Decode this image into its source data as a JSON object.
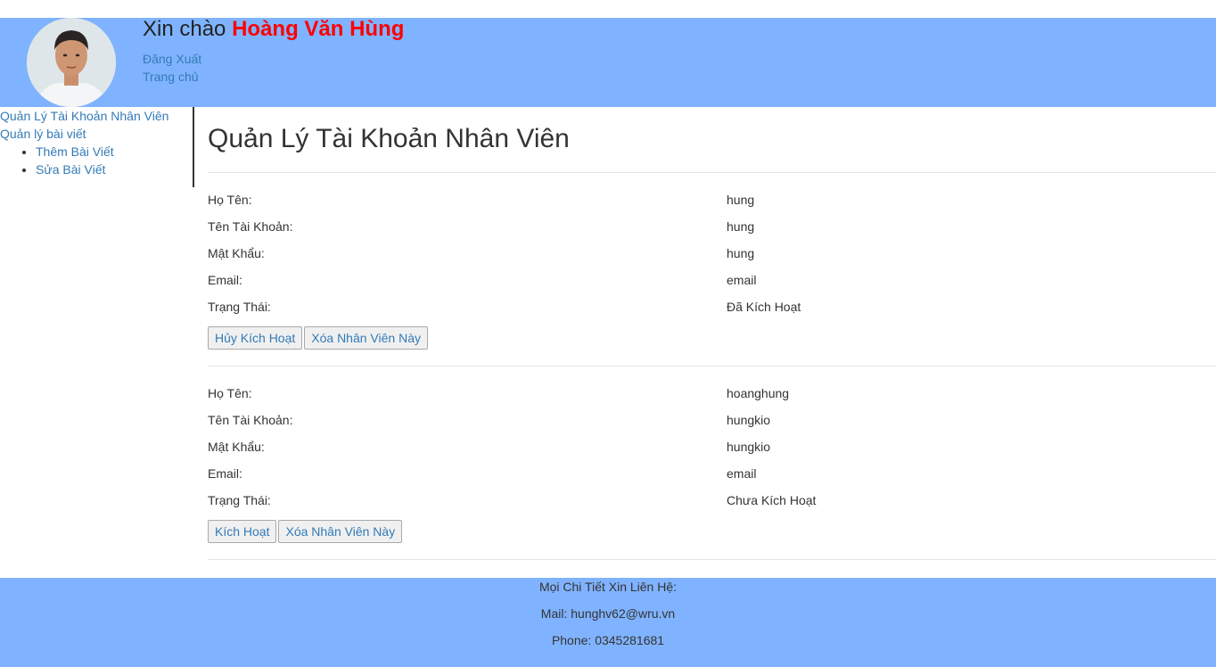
{
  "header": {
    "greeting_prefix": "Xin chào",
    "user_name": "Hoàng Văn Hùng",
    "logout_label": "Đăng Xuất",
    "home_label": "Trang chủ"
  },
  "sidebar": {
    "accounts_label": "Quản Lý Tài Khoản Nhân Viên",
    "posts_label": "Quản lý bài viết",
    "sub_items": [
      {
        "label": "Thêm Bài Viết"
      },
      {
        "label": "Sửa Bài Viết"
      }
    ]
  },
  "main": {
    "title": "Quản Lý Tài Khoản Nhân Viên",
    "field_labels": {
      "name": "Họ Tên:",
      "username": "Tên Tài Khoản:",
      "password": "Mật Khẩu:",
      "email": "Email:",
      "status": "Trạng Thái:"
    },
    "employees": [
      {
        "name": "hung",
        "username": "hung",
        "password": "hung",
        "email": "email",
        "status": "Đã Kích Hoạt",
        "toggle_label": "Hủy Kích Hoạt",
        "delete_label": "Xóa Nhân Viên Này"
      },
      {
        "name": "hoanghung",
        "username": "hungkio",
        "password": "hungkio",
        "email": "email",
        "status": "Chưa Kích Hoạt",
        "toggle_label": "Kích Hoạt",
        "delete_label": "Xóa Nhân Viên Này"
      }
    ]
  },
  "footer": {
    "contact_title": "Mọi Chi Tiết Xin Liên Hệ:",
    "mail": "Mail: hunghv62@wru.vn",
    "phone": "Phone: 0345281681"
  },
  "colors": {
    "header_bg": "#80b3ff",
    "footer_bg": "#80b3ff",
    "link": "#337ab7",
    "user_name": "#ff0000"
  }
}
